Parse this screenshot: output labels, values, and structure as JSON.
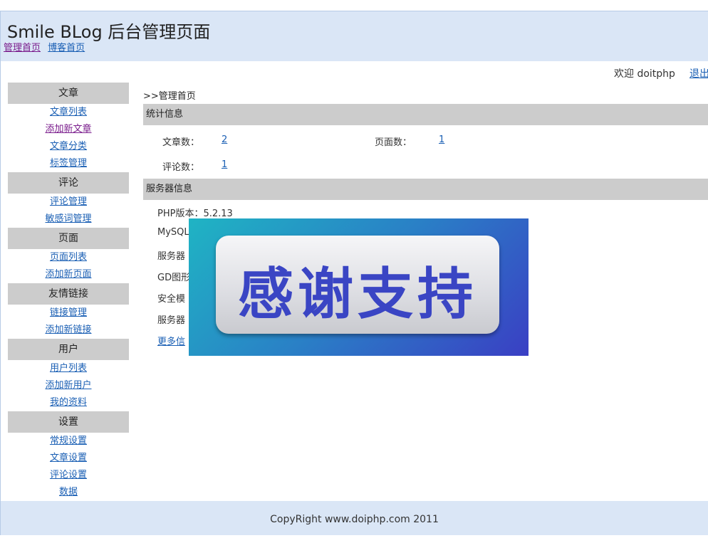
{
  "header": {
    "title": "Smile BLog 后台管理页面",
    "links": [
      "管理首页",
      "博客首页"
    ]
  },
  "userbar": {
    "welcome": "欢迎 doitphp",
    "logout": "退出"
  },
  "sidebar": {
    "sections": [
      {
        "title": "文章",
        "items": [
          "文章列表",
          "添加新文章",
          "文章分类",
          "标签管理"
        ]
      },
      {
        "title": "评论",
        "items": [
          "评论管理",
          "敏感词管理"
        ]
      },
      {
        "title": "页面",
        "items": [
          "页面列表",
          "添加新页面"
        ]
      },
      {
        "title": "友情链接",
        "items": [
          "链接管理",
          "添加新链接"
        ]
      },
      {
        "title": "用户",
        "items": [
          "用户列表",
          "添加新用户",
          "我的资料"
        ]
      },
      {
        "title": "设置",
        "items": [
          "常规设置",
          "文章设置",
          "评论设置",
          "数据"
        ]
      }
    ]
  },
  "main": {
    "breadcrumb": ">>管理首页",
    "stats": {
      "title": "统计信息",
      "article_label": "文章数：",
      "article_count": "2",
      "page_label": "页面数：",
      "page_count": "1",
      "comment_label": "评论数：",
      "comment_count": "1"
    },
    "server": {
      "title": "服务器信息",
      "lines": [
        "PHP版本：5.2.13",
        "MySQL",
        "服务器",
        "GD图形",
        "安全模",
        "服务器"
      ],
      "more": "更多信"
    }
  },
  "overlay": {
    "text": "感谢支持"
  },
  "footer": {
    "copyright": "CopyRight www.doiphp.com 2011"
  }
}
